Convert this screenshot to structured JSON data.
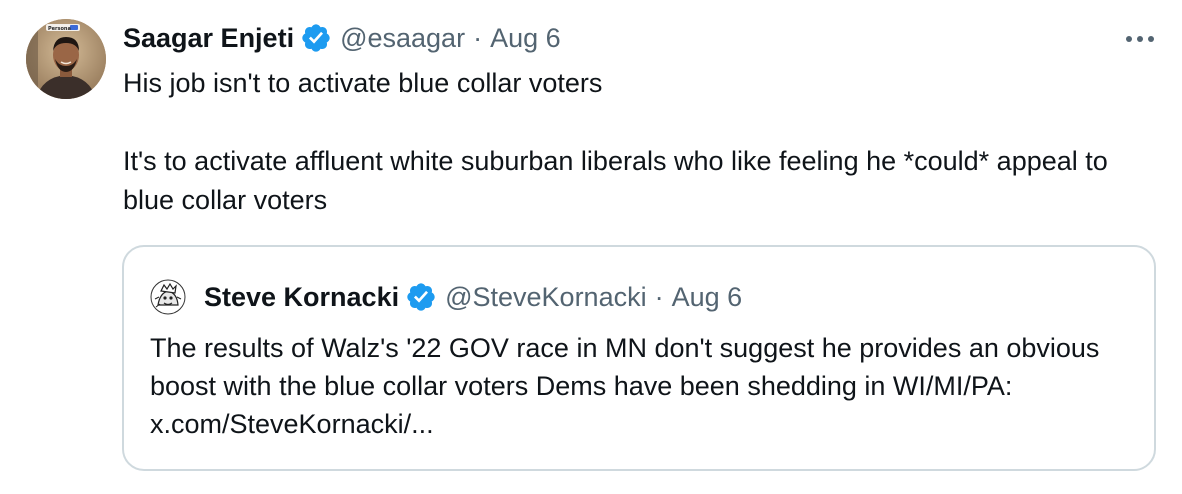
{
  "tweet": {
    "author_name": "Saagar Enjeti",
    "author_handle": "@esaagar",
    "separator": "·",
    "date": "Aug 6",
    "avatar_badge_text": "Persona",
    "paragraphs": [
      "His job isn't to activate blue collar voters",
      "It's to activate affluent white suburban liberals who like feeling he *could* appeal to blue collar voters"
    ],
    "verified_color": "#1d9bf0"
  },
  "quoted_tweet": {
    "author_name": "Steve Kornacki",
    "author_handle": "@SteveKornacki",
    "separator": "·",
    "date": "Aug 6",
    "text": "The results of Walz's '22 GOV race in MN don't suggest he provides an obvious boost with the blue collar voters Dems have been shedding in WI/MI/PA: x.com/SteveKornacki/..."
  },
  "icons": {
    "verified": "verified-badge-icon",
    "more": "more-options-icon"
  }
}
